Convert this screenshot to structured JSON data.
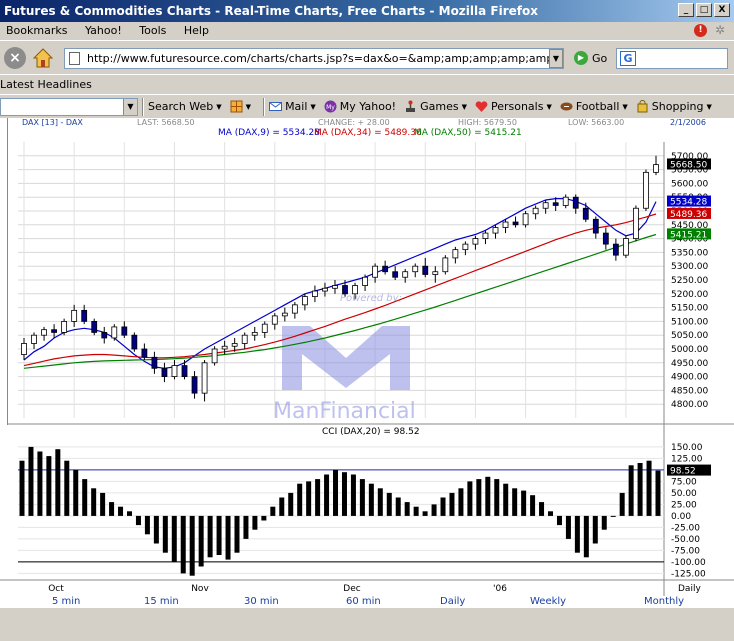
{
  "window": {
    "title": "Futures & Commodities Charts - Real-Time Charts, Free Charts - Mozilla Firefox",
    "btn_min": "_",
    "btn_max": "□",
    "btn_close": "X"
  },
  "menu": {
    "bookmarks": "Bookmarks",
    "yahoo": "Yahoo!",
    "tools": "Tools",
    "help": "Help"
  },
  "nav": {
    "url": "http://www.futuresource.com/charts/charts.jsp?s=dax&o=&amp;amp;amp;amp;amp;amp;amp;amp;amp;a=E",
    "go_label": "Go",
    "search_glyph": "G"
  },
  "bookmarks_bar": {
    "latest_headlines": "Latest Headlines"
  },
  "yahoo_toolbar": {
    "search_web": "Search Web",
    "mail": "Mail",
    "my_yahoo": "My Yahoo!",
    "games": "Games",
    "personals": "Personals",
    "football": "Football",
    "shopping": "Shopping"
  },
  "chart_header": {
    "symbol": "DAX [13] - DAX",
    "last": "LAST: 5668.50",
    "change": "CHANGE: + 28.00",
    "high": "HIGH: 5679.50",
    "low": "LOW: 5663.00",
    "date": "2/1/2006",
    "ma9": "MA (DAX,9) = 5534.28",
    "ma34": "MA (DAX,34) = 5489.36",
    "ma50": "MA (DAX,50) = 5415.21",
    "cci_label": "CCI (DAX,20) = 98.52"
  },
  "watermark": {
    "powered": "Powered by:",
    "brand": "ManFinancial"
  },
  "timeframes": {
    "m5": "5 min",
    "m15": "15 min",
    "m30": "30 min",
    "m60": "60 min",
    "daily": "Daily",
    "weekly": "Weekly",
    "monthly": "Monthly"
  },
  "colors": {
    "ma9": "#0000cc",
    "ma34": "#cc0000",
    "ma50": "#008000",
    "candle_up": "#ffffff",
    "candle_down": "#000080"
  },
  "chart_data": [
    {
      "type": "candlestick",
      "title": "DAX [13] - DAX",
      "ylim": [
        4750,
        5750
      ],
      "y_ticks": [
        5700,
        5650,
        5600,
        5550,
        5500,
        5450,
        5400,
        5350,
        5300,
        5250,
        5200,
        5150,
        5100,
        5050,
        5000,
        4950,
        4900,
        4850,
        4800
      ],
      "x_tick_labels": [
        "Oct",
        "Nov",
        "Dec",
        "'06",
        "Daily"
      ],
      "price_tags": {
        "last": "5668.50",
        "ma9": "5534.28",
        "ma34": "5489.36",
        "ma50": "5415.21"
      },
      "series": [
        {
          "name": "MA (DAX,9)",
          "values": [
            4960,
            4990,
            5010,
            5040,
            5060,
            5070,
            5075,
            5070,
            5060,
            5040,
            5010,
            4980,
            4955,
            4935,
            4930,
            4935,
            4950,
            4975,
            5000,
            5020,
            5040,
            5060,
            5080,
            5100,
            5120,
            5140,
            5160,
            5180,
            5200,
            5210,
            5220,
            5230,
            5240,
            5250,
            5260,
            5275,
            5290,
            5305,
            5320,
            5335,
            5350,
            5365,
            5380,
            5395,
            5405,
            5415,
            5430,
            5450,
            5470,
            5490,
            5510,
            5525,
            5540,
            5545,
            5545,
            5535,
            5520,
            5490,
            5460,
            5430,
            5410,
            5420,
            5460,
            5534
          ]
        },
        {
          "name": "MA (DAX,34)",
          "values": [
            4940,
            4948,
            4956,
            4964,
            4970,
            4975,
            4978,
            4980,
            4980,
            4978,
            4975,
            4972,
            4970,
            4968,
            4968,
            4970,
            4972,
            4976,
            4980,
            4985,
            4990,
            4995,
            5000,
            5008,
            5016,
            5025,
            5035,
            5046,
            5058,
            5070,
            5082,
            5095,
            5108,
            5120,
            5132,
            5145,
            5158,
            5172,
            5186,
            5200,
            5214,
            5228,
            5242,
            5256,
            5270,
            5284,
            5298,
            5312,
            5326,
            5340,
            5354,
            5368,
            5382,
            5396,
            5408,
            5420,
            5430,
            5438,
            5444,
            5450,
            5458,
            5468,
            5478,
            5489
          ]
        },
        {
          "name": "MA (DAX,50)",
          "values": [
            4930,
            4934,
            4938,
            4942,
            4946,
            4950,
            4953,
            4955,
            4957,
            4958,
            4959,
            4960,
            4961,
            4962,
            4963,
            4965,
            4967,
            4970,
            4973,
            4976,
            4980,
            4984,
            4988,
            4993,
            4998,
            5004,
            5010,
            5017,
            5024,
            5032,
            5040,
            5049,
            5058,
            5067,
            5077,
            5087,
            5097,
            5108,
            5119,
            5130,
            5141,
            5152,
            5164,
            5176,
            5188,
            5200,
            5212,
            5224,
            5236,
            5248,
            5260,
            5272,
            5284,
            5296,
            5308,
            5320,
            5332,
            5344,
            5356,
            5368,
            5380,
            5392,
            5404,
            5415
          ]
        }
      ],
      "candles": [
        [
          4980,
          5040,
          4960,
          5020
        ],
        [
          5020,
          5060,
          5000,
          5050
        ],
        [
          5050,
          5080,
          5030,
          5070
        ],
        [
          5070,
          5090,
          5040,
          5060
        ],
        [
          5060,
          5110,
          5050,
          5100
        ],
        [
          5100,
          5160,
          5080,
          5140
        ],
        [
          5140,
          5160,
          5090,
          5100
        ],
        [
          5100,
          5110,
          5050,
          5060
        ],
        [
          5060,
          5080,
          5020,
          5040
        ],
        [
          5040,
          5090,
          5030,
          5080
        ],
        [
          5080,
          5100,
          5040,
          5050
        ],
        [
          5050,
          5060,
          4990,
          5000
        ],
        [
          5000,
          5020,
          4960,
          4970
        ],
        [
          4970,
          4990,
          4910,
          4930
        ],
        [
          4930,
          4950,
          4880,
          4900
        ],
        [
          4900,
          4960,
          4890,
          4940
        ],
        [
          4940,
          4960,
          4890,
          4900
        ],
        [
          4900,
          4920,
          4820,
          4840
        ],
        [
          4840,
          4960,
          4810,
          4950
        ],
        [
          4950,
          5010,
          4940,
          5000
        ],
        [
          5000,
          5030,
          4980,
          5010
        ],
        [
          5010,
          5040,
          4990,
          5020
        ],
        [
          5020,
          5060,
          5000,
          5050
        ],
        [
          5050,
          5080,
          5030,
          5060
        ],
        [
          5060,
          5100,
          5040,
          5090
        ],
        [
          5090,
          5130,
          5070,
          5120
        ],
        [
          5120,
          5150,
          5100,
          5130
        ],
        [
          5130,
          5170,
          5110,
          5160
        ],
        [
          5160,
          5200,
          5140,
          5190
        ],
        [
          5190,
          5230,
          5170,
          5210
        ],
        [
          5210,
          5240,
          5190,
          5220
        ],
        [
          5220,
          5250,
          5200,
          5230
        ],
        [
          5230,
          5250,
          5190,
          5200
        ],
        [
          5200,
          5240,
          5180,
          5230
        ],
        [
          5230,
          5270,
          5210,
          5260
        ],
        [
          5260,
          5310,
          5240,
          5300
        ],
        [
          5300,
          5320,
          5270,
          5280
        ],
        [
          5280,
          5300,
          5250,
          5260
        ],
        [
          5260,
          5290,
          5240,
          5280
        ],
        [
          5280,
          5310,
          5260,
          5300
        ],
        [
          5300,
          5330,
          5260,
          5270
        ],
        [
          5270,
          5300,
          5240,
          5280
        ],
        [
          5280,
          5340,
          5270,
          5330
        ],
        [
          5330,
          5370,
          5310,
          5360
        ],
        [
          5360,
          5390,
          5340,
          5380
        ],
        [
          5380,
          5410,
          5360,
          5400
        ],
        [
          5400,
          5430,
          5380,
          5420
        ],
        [
          5420,
          5450,
          5400,
          5440
        ],
        [
          5440,
          5470,
          5420,
          5460
        ],
        [
          5460,
          5480,
          5440,
          5450
        ],
        [
          5450,
          5500,
          5440,
          5490
        ],
        [
          5490,
          5520,
          5470,
          5510
        ],
        [
          5510,
          5540,
          5490,
          5530
        ],
        [
          5530,
          5550,
          5500,
          5520
        ],
        [
          5520,
          5560,
          5510,
          5550
        ],
        [
          5550,
          5560,
          5490,
          5510
        ],
        [
          5510,
          5530,
          5460,
          5470
        ],
        [
          5470,
          5480,
          5400,
          5420
        ],
        [
          5420,
          5440,
          5360,
          5380
        ],
        [
          5380,
          5400,
          5320,
          5340
        ],
        [
          5340,
          5410,
          5330,
          5400
        ],
        [
          5400,
          5520,
          5390,
          5510
        ],
        [
          5510,
          5650,
          5500,
          5640
        ],
        [
          5640,
          5700,
          5630,
          5668
        ]
      ]
    },
    {
      "type": "bar",
      "title": "CCI (DAX,20) = 98.52",
      "ylim": [
        -135,
        165
      ],
      "y_ticks": [
        150,
        125,
        100,
        75,
        50,
        25,
        0,
        -25,
        -50,
        -75,
        -100,
        -125
      ],
      "value_tag": "98.52",
      "reference_lines": [
        100,
        -100
      ],
      "values": [
        120,
        150,
        140,
        130,
        145,
        120,
        100,
        80,
        60,
        50,
        30,
        20,
        10,
        -20,
        -40,
        -60,
        -80,
        -100,
        -125,
        -130,
        -110,
        -90,
        -85,
        -95,
        -80,
        -50,
        -30,
        -10,
        20,
        40,
        50,
        70,
        75,
        80,
        90,
        100,
        95,
        90,
        80,
        70,
        60,
        50,
        40,
        30,
        20,
        10,
        25,
        40,
        50,
        60,
        75,
        80,
        85,
        80,
        70,
        60,
        55,
        45,
        30,
        10,
        -20,
        -50,
        -80,
        -90,
        -60,
        -30,
        0,
        50,
        110,
        115,
        120,
        98.52
      ]
    }
  ]
}
